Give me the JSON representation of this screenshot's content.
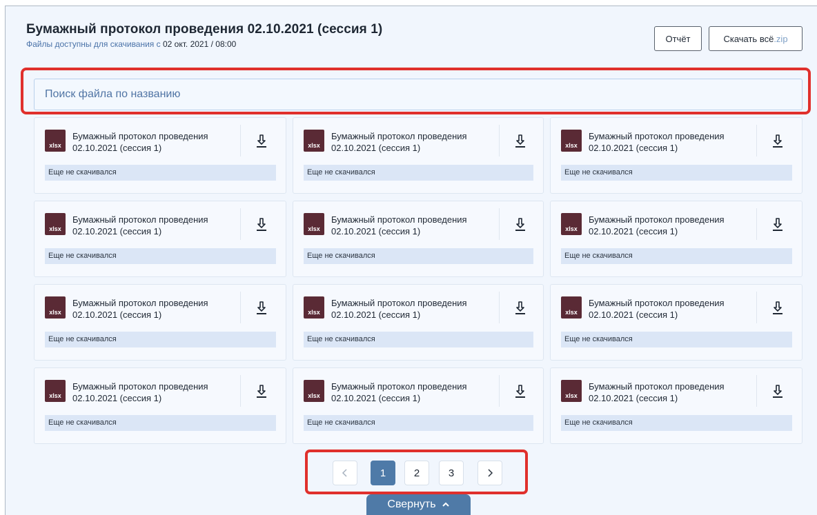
{
  "header": {
    "title": "Бумажный протокол проведения 02.10.2021 (сессия 1)",
    "subtitle_prefix": "Файлы доступны для скачивания с",
    "subtitle_date": "02 окт. 2021 / 08:00"
  },
  "toolbar": {
    "report_label": "Отчёт",
    "download_all_label": "Скачать всё",
    "download_all_ext": ".zip"
  },
  "search": {
    "placeholder": "Поиск файла по названию",
    "value": ""
  },
  "files": [
    {
      "name_line1": "Бумажный протокол проведения",
      "name_line2": "02.10.2021 (сессия 1)",
      "type": "xlsx",
      "status": "Еще не скачивался"
    },
    {
      "name_line1": "Бумажный протокол проведения",
      "name_line2": "02.10.2021 (сессия 1)",
      "type": "xlsx",
      "status": "Еще не скачивался"
    },
    {
      "name_line1": "Бумажный протокол проведения",
      "name_line2": "02.10.2021 (сессия 1)",
      "type": "xlsx",
      "status": "Еще не скачивался"
    },
    {
      "name_line1": "Бумажный протокол проведения",
      "name_line2": "02.10.2021 (сессия 1)",
      "type": "xlsx",
      "status": "Еще не скачивался"
    },
    {
      "name_line1": "Бумажный протокол проведения",
      "name_line2": "02.10.2021 (сессия 1)",
      "type": "xlsx",
      "status": "Еще не скачивался"
    },
    {
      "name_line1": "Бумажный протокол проведения",
      "name_line2": "02.10.2021 (сессия 1)",
      "type": "xlsx",
      "status": "Еще не скачивался"
    },
    {
      "name_line1": "Бумажный протокол проведения",
      "name_line2": "02.10.2021 (сессия 1)",
      "type": "xlsx",
      "status": "Еще не скачивался"
    },
    {
      "name_line1": "Бумажный протокол проведения",
      "name_line2": "02.10.2021 (сессия 1)",
      "type": "xlsx",
      "status": "Еще не скачивался"
    },
    {
      "name_line1": "Бумажный протокол проведения",
      "name_line2": "02.10.2021 (сессия 1)",
      "type": "xlsx",
      "status": "Еще не скачивался"
    },
    {
      "name_line1": "Бумажный протокол проведения",
      "name_line2": "02.10.2021 (сессия 1)",
      "type": "xlsx",
      "status": "Еще не скачивался"
    },
    {
      "name_line1": "Бумажный протокол проведения",
      "name_line2": "02.10.2021 (сессия 1)",
      "type": "xlsx",
      "status": "Еще не скачивался"
    },
    {
      "name_line1": "Бумажный протокол проведения",
      "name_line2": "02.10.2021 (сессия 1)",
      "type": "xlsx",
      "status": "Еще не скачивался"
    }
  ],
  "pagination": {
    "prev_icon": "chevron-left-icon",
    "next_icon": "chevron-right-icon",
    "pages": [
      "1",
      "2",
      "3"
    ],
    "current": "1"
  },
  "collapse": {
    "label": "Свернуть",
    "icon": "chevron-up-icon"
  },
  "colors": {
    "accent": "#4f7aa7",
    "highlight": "#e0302c",
    "file_icon": "#5a2a35",
    "status_bg": "#dbe6f6"
  }
}
